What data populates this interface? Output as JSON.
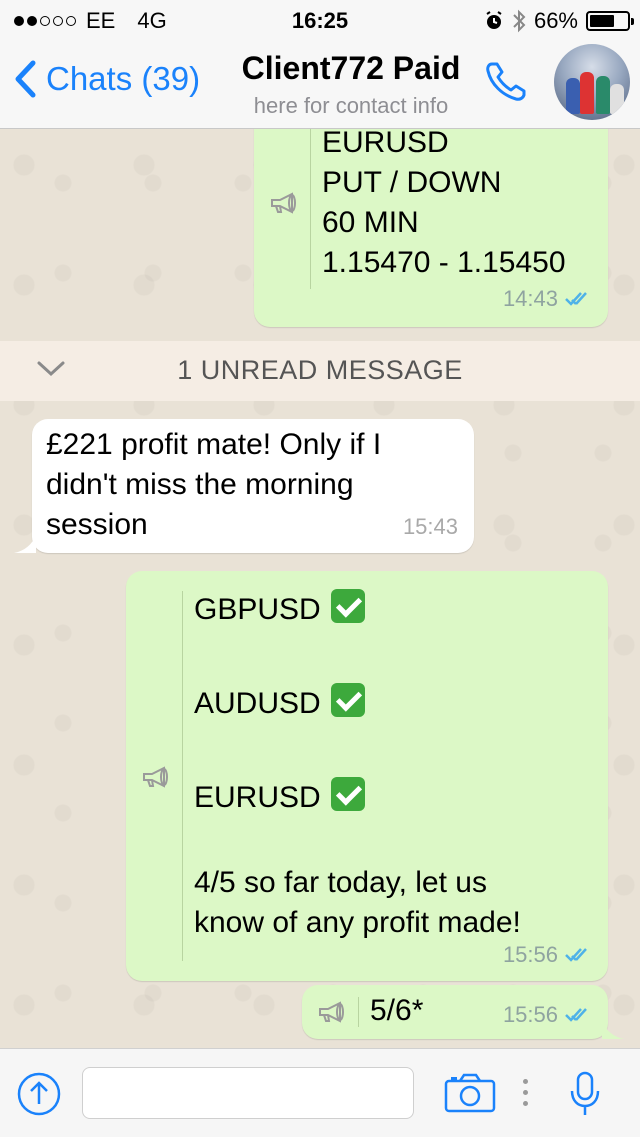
{
  "status_bar": {
    "carrier": "EE",
    "network": "4G",
    "time": "16:25",
    "battery": "66%",
    "battery_level": 0.66,
    "signal_bars_filled": 2,
    "signal_bars_total": 5
  },
  "nav": {
    "back_label": "Chats (39)",
    "title": "Client772 Paid",
    "subtitle": "here for contact info"
  },
  "messages": [
    {
      "direction": "outgoing",
      "text": "EURUSD\nPUT / DOWN\n60 MIN\n1.15470 - 1.15450",
      "time": "14:43",
      "broadcast": true,
      "read": true
    },
    {
      "direction": "incoming",
      "text": "£221 profit mate! Only if I\ndidn't miss the morning\nsession",
      "time": "15:43"
    },
    {
      "direction": "outgoing",
      "lines": [
        "GBPUSD",
        "AUDUSD",
        "EURUSD"
      ],
      "footer": "4/5 so far today, let us\nknow of any profit made!",
      "time": "15:56",
      "broadcast": true,
      "read": true
    },
    {
      "direction": "outgoing",
      "text": "5/6*",
      "time": "15:56",
      "broadcast": true,
      "read": true
    }
  ],
  "unread_divider": "1 UNREAD MESSAGE",
  "input": {
    "value": "",
    "placeholder": ""
  },
  "icons": {
    "back": "chevron-left-icon",
    "call": "phone-icon",
    "broadcast": "megaphone-icon",
    "ticks": "double-check-icon",
    "upload": "upload-arrow-icon",
    "camera": "camera-icon",
    "mic": "microphone-icon",
    "check": "green-check-emoji"
  },
  "colors": {
    "accent": "#1a82fb",
    "outgoing_bubble": "#dcf8c6",
    "incoming_bubble": "#ffffff",
    "read_ticks": "#4fb2e8"
  }
}
